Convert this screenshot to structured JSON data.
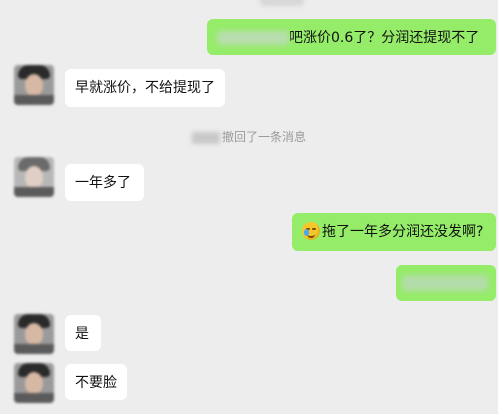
{
  "messages": [
    {
      "id": "m1",
      "side": "right",
      "text": "吧涨价0.6了？分润还提现不了",
      "blurred_prefix": true
    },
    {
      "id": "m2",
      "side": "left",
      "text": "早就涨价，不给提现了"
    },
    {
      "id": "m3",
      "side": "system",
      "text": "撤回了一条消息"
    },
    {
      "id": "m4",
      "side": "left",
      "text": "一年多了"
    },
    {
      "id": "m5",
      "side": "right",
      "text": "拖了一年多分润还没发啊?",
      "emoji": "crying-laughing-emoji"
    },
    {
      "id": "m6",
      "side": "right",
      "text": "",
      "redacted": true
    },
    {
      "id": "m7",
      "side": "left",
      "text": "是"
    },
    {
      "id": "m8",
      "side": "left",
      "text": "不要脸"
    }
  ],
  "colors": {
    "background": "#ededed",
    "outgoing_bubble": "#95ec69",
    "incoming_bubble": "#ffffff",
    "system_text": "#9b9b9b"
  }
}
